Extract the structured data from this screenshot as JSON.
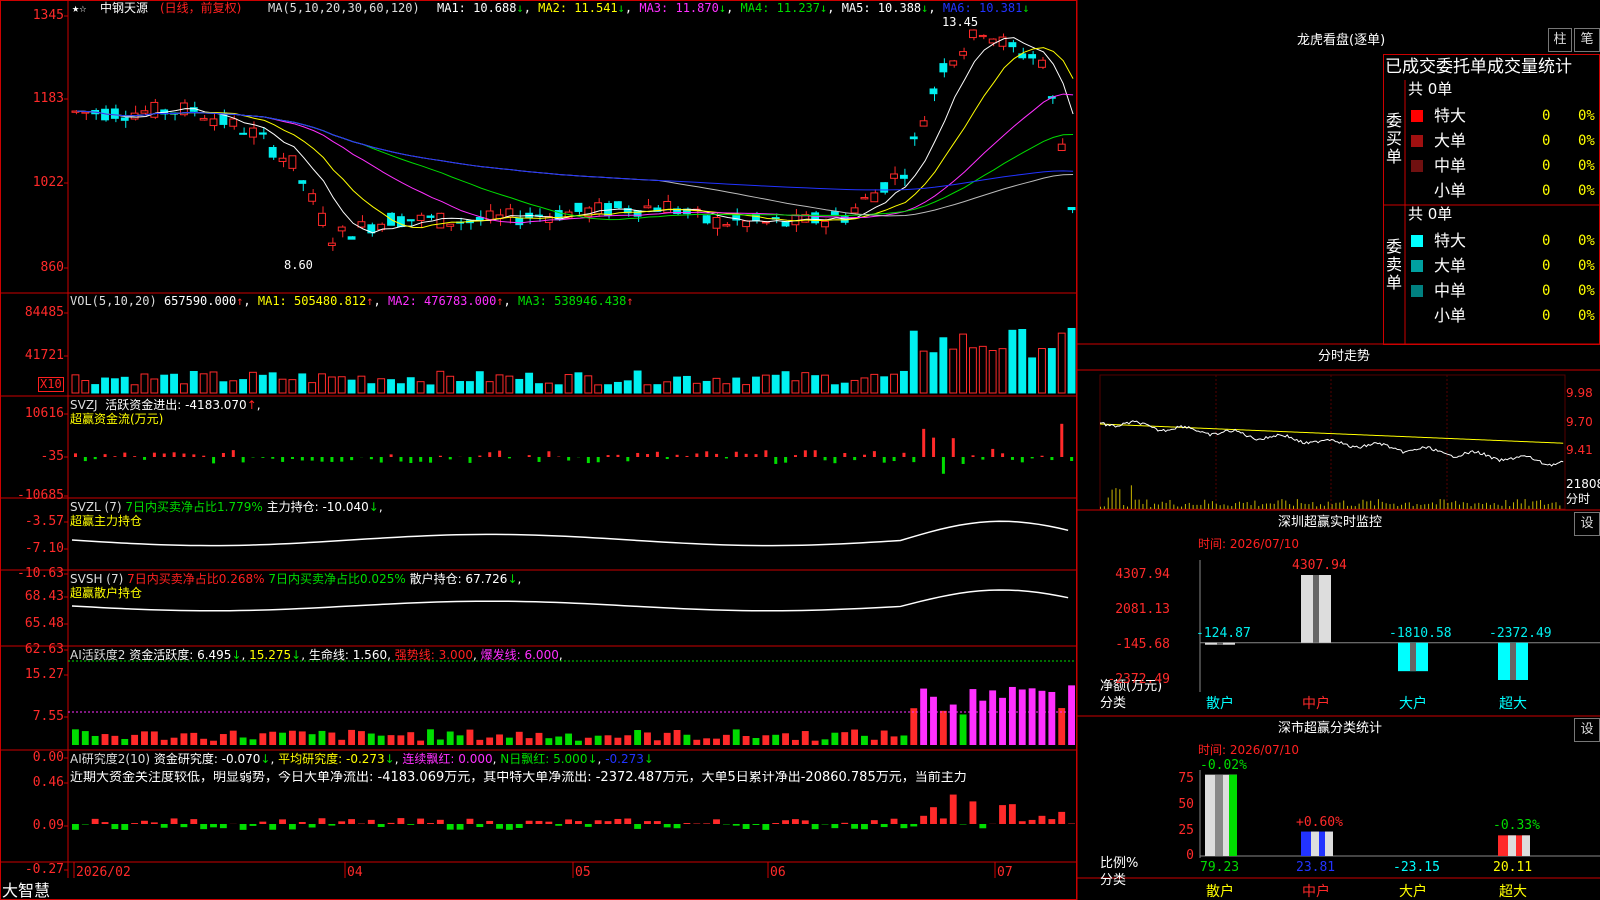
{
  "colors": {
    "up": "#ff2a2a",
    "down": "#00f0f0",
    "axis": "#cc0000",
    "white": "#ffffff",
    "yellow": "#ffff00",
    "magenta": "#ff30ff",
    "green": "#00dd00",
    "blue": "#2233ff",
    "gray": "#bbbbbb",
    "cyan": "#00ffff"
  },
  "header": {
    "icon": "star-icon",
    "stock": "中钢天源",
    "mode": "(日线，前复权)",
    "ma_label": "MA(5,10,20,30,60,120)",
    "ma": [
      {
        "t": "MA1: 10.688",
        "arrow": "↓",
        "color": "#ffffff"
      },
      {
        "t": "MA2: 11.541",
        "arrow": "↓",
        "color": "#ffff00"
      },
      {
        "t": "MA3: 11.870",
        "arrow": "↓",
        "color": "#ff30ff"
      },
      {
        "t": "MA4: 11.237",
        "arrow": "↓",
        "color": "#00dd00"
      },
      {
        "t": "MA5: 10.388",
        "arrow": "↓",
        "color": "#ffffff"
      },
      {
        "t": "MA6: 10.381",
        "arrow": "↓",
        "color": "#2233ff"
      }
    ],
    "high_mark": "13.45",
    "low_mark": "8.60"
  },
  "price_axis": [
    "1345",
    "1183",
    "1022",
    "860"
  ],
  "vol_panel": {
    "title": "VOL(5,10,20)",
    "value": "657590.000",
    "items": [
      {
        "t": "MA1: 505480.812",
        "color": "#ffff00"
      },
      {
        "t": "MA2: 476783.000",
        "color": "#ff30ff"
      },
      {
        "t": "MA3: 538946.438",
        "color": "#00dd00"
      }
    ],
    "axis": [
      "84485",
      "41721"
    ],
    "unit": "X10"
  },
  "svzj_panel": {
    "title": "SVZJ",
    "label": "活跃资金进出: -4183.070",
    "sub": "超赢资金流(万元)",
    "axis": [
      "10616",
      "-35",
      "-10685"
    ]
  },
  "svzl_panel": {
    "title": "SVZL (7)",
    "seg1": "7日内买卖净占比1.779%",
    "seg2": "主力持仓: -10.040",
    "sub": "超赢主力持仓",
    "axis": [
      "-3.57",
      "-7.10",
      "-10.63"
    ]
  },
  "svsh_panel": {
    "title": "SVSH (7)",
    "seg1": "7日内买卖净占比0.268%",
    "seg2": "7日内买卖净占比0.025%",
    "seg3": "散户持仓: 67.726",
    "sub": "超赢散户持仓",
    "axis": [
      "68.43",
      "65.48",
      "62.63"
    ]
  },
  "ai1_panel": {
    "title": "AI活跃度2",
    "seg1": "资金活跃度: 6.495",
    "seg2": "15.275",
    "seg3": "生命线: 1.560",
    "seg4": "强势线: 3.000",
    "seg5": "爆发线: 6.000",
    "axis": [
      "15.27",
      "7.55",
      "0.00"
    ]
  },
  "ai2_panel": {
    "title": "AI研究度2(10)",
    "seg1": "资金研究度: -0.070",
    "seg2": "平均研究度: -0.273",
    "seg3": "连续飘红: 0.000",
    "seg4": "N日飘红: 5.000",
    "seg5": "-0.273",
    "comment": "近期大资金关注度较低，明显弱势，今日大单净流出: -4183.069万元，其中特大单净流出: -2372.487万元，大单5日累计净出-20860.785万元，当前主力",
    "axis": [
      "0.46",
      "0.09",
      "-0.27"
    ]
  },
  "date_axis": [
    "2026/02",
    "04",
    "05",
    "06",
    "07"
  ],
  "brand": "大智慧",
  "right": {
    "lhb_title": "龙虎看盘(逐单)",
    "btn_zhu": "柱",
    "btn_bi": "笔",
    "tabs": "已成交委托单成交量统计",
    "buy_label": "委买单",
    "sell_label": "委卖单",
    "buy_total": "共 0单",
    "sell_total": "共 0单",
    "buy_rows": [
      {
        "name": "特大",
        "color": "#ff0000",
        "n": "0",
        "p": "0%"
      },
      {
        "name": "大单",
        "color": "#a01010",
        "n": "0",
        "p": "0%"
      },
      {
        "name": "中单",
        "color": "#701010",
        "n": "0",
        "p": "0%"
      },
      {
        "name": "小单",
        "color": "",
        "n": "0",
        "p": "0%"
      }
    ],
    "sell_rows": [
      {
        "name": "特大",
        "color": "#00ffff",
        "n": "0",
        "p": "0%"
      },
      {
        "name": "大单",
        "color": "#00a0a0",
        "n": "0",
        "p": "0%"
      },
      {
        "name": "中单",
        "color": "#008080",
        "n": "0",
        "p": "0%"
      },
      {
        "name": "小单",
        "color": "",
        "n": "0",
        "p": "0%"
      }
    ],
    "intraday_title": "分时走势",
    "intraday_axis": [
      "9.98",
      "9.70",
      "9.41",
      "21808",
      "分时"
    ],
    "monitor_title": "深圳超赢实时监控",
    "monitor_btn": "设",
    "monitor_time": "时间: 2026/07/10",
    "monitor_axis": [
      "4307.94",
      "2081.13",
      "-145.68",
      "-2372.49"
    ],
    "monitor_ylabel": "净额(万元)",
    "monitor_xlabel": "分类",
    "stats_title": "深市超赢分类统计",
    "stats_btn": "设",
    "stats_time": "时间: 2026/07/10",
    "stats_axis": [
      "75",
      "50",
      "25",
      "0"
    ],
    "stats_ylabel": "比例%",
    "stats_xlabel": "分类"
  },
  "chart_data": [
    {
      "type": "bar",
      "title": "深圳超赢实时监控",
      "categories": [
        "散户",
        "中户",
        "大户",
        "超大"
      ],
      "values": [
        -124.87,
        4307.94,
        -1810.58,
        -2372.49
      ],
      "ylim": [
        -2372.49,
        4307.94
      ]
    },
    {
      "type": "bar",
      "title": "深市超赢分类统计",
      "categories": [
        "散户",
        "中户",
        "大户",
        "超大"
      ],
      "values": [
        79.23,
        23.81,
        -23.15,
        20.11
      ],
      "changes": [
        "-0.02%",
        "+0.60%",
        "",
        "-0.33%"
      ],
      "ylim": [
        0,
        75
      ]
    },
    {
      "type": "line",
      "title": "分时走势",
      "ylim": [
        9.41,
        9.98
      ]
    }
  ]
}
